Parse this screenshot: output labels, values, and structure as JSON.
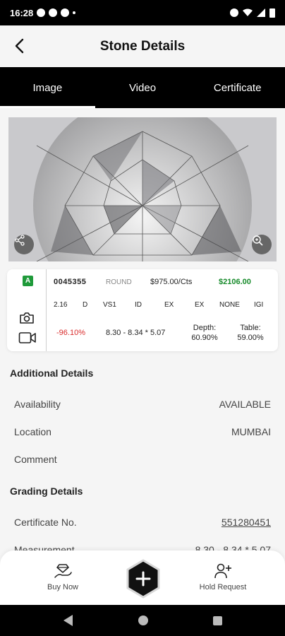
{
  "status": {
    "time": "16:28"
  },
  "header": {
    "title": "Stone Details"
  },
  "tabs": [
    {
      "label": "Image"
    },
    {
      "label": "Video"
    },
    {
      "label": "Certificate"
    }
  ],
  "card": {
    "grade": "A",
    "stone_id": "0045355",
    "shape": "ROUND",
    "price_per_ct": "$975.00/Cts",
    "total": "$2106.00",
    "carat": "2.16",
    "color": "D",
    "clarity": "VS1",
    "cut": "ID",
    "polish": "EX",
    "symmetry": "EX",
    "fluorescence": "NONE",
    "lab": "IGI",
    "discount": "-96.10%",
    "measurement": "8.30 - 8.34 * 5.07",
    "depth_label": "Depth:",
    "depth": "60.90%",
    "table_label": "Table:",
    "table": "59.00%"
  },
  "additional": {
    "heading": "Additional Details",
    "rows": [
      {
        "label": "Availability",
        "value": "AVAILABLE"
      },
      {
        "label": "Location",
        "value": "MUMBAI"
      },
      {
        "label": "Comment",
        "value": ""
      }
    ]
  },
  "grading": {
    "heading": "Grading Details",
    "rows": [
      {
        "label": "Certificate No.",
        "value": "551280451"
      },
      {
        "label": "Measurement",
        "value": "8.30 - 8.34 * 5.07"
      }
    ]
  },
  "bottom": {
    "buy_now": "Buy Now",
    "hold_request": "Hold Request"
  },
  "icons": [
    "back-arrow-icon",
    "share-icon",
    "zoom-icon",
    "camera-icon",
    "video-icon",
    "diamond-hand-icon",
    "plus-icon",
    "add-user-icon"
  ]
}
